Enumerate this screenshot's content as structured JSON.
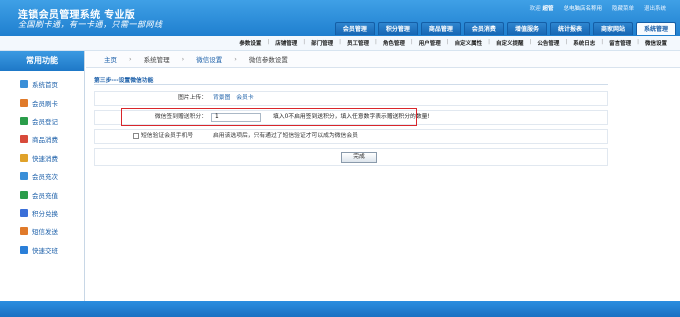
{
  "app": {
    "title": "连锁会员管理系统 专业版",
    "slogan": "全国刷卡通，有一卡通，只需一部网线"
  },
  "userbar": {
    "welcome": "欢迎",
    "username": "超管",
    "shop": "总电脑店名称用",
    "switch_label": "隐藏菜单",
    "logout_label": "退出系统"
  },
  "main_tabs": [
    "会员管理",
    "积分管理",
    "商品管理",
    "会员消费",
    "增值服务",
    "统计报表",
    "商家网站",
    "系统管理"
  ],
  "main_tab_active": "系统管理",
  "subnav": [
    "参数设置",
    "店铺管理",
    "部门管理",
    "员工管理",
    "角色管理",
    "用户管理",
    "自定义属性",
    "自定义提醒",
    "公告管理",
    "系统日志",
    "留言管理",
    "微信设置"
  ],
  "sidebar": {
    "title": "常用功能",
    "items": [
      {
        "label": "系统首页",
        "icon": "home-icon",
        "color": "#3a8fd8"
      },
      {
        "label": "会员刷卡",
        "icon": "user-card-icon",
        "color": "#e07a2a"
      },
      {
        "label": "会员登记",
        "icon": "user-add-icon",
        "color": "#2a9d4a"
      },
      {
        "label": "商品消费",
        "icon": "shopping-icon",
        "color": "#d84a3a"
      },
      {
        "label": "快速消费",
        "icon": "fast-pay-icon",
        "color": "#e0a22a"
      },
      {
        "label": "会员充次",
        "icon": "recharge-times-icon",
        "color": "#3a8fd8"
      },
      {
        "label": "会员充值",
        "icon": "recharge-money-icon",
        "color": "#2a9d4a"
      },
      {
        "label": "积分兑换",
        "icon": "points-icon",
        "color": "#3a6fd8"
      },
      {
        "label": "短信发送",
        "icon": "sms-icon",
        "color": "#e07a2a"
      },
      {
        "label": "快速交班",
        "icon": "shift-icon",
        "color": "#2a7fd8"
      }
    ]
  },
  "breadcrumb": [
    "主页",
    "系统管理",
    "微信设置",
    "微信参数设置"
  ],
  "step_title": "第三步---设置微信功能",
  "form": {
    "image_label": "图片上传：",
    "image_links": [
      "背景图",
      "会员卡"
    ],
    "points_label": "微信签到赠送积分：",
    "points_value": "1",
    "points_hint": "填入0不启用签到送积分，填入任意数字表示赠送积分的数量!",
    "sms_label": "短信验证会员手机号",
    "sms_hint": "启用该选项后，只有通过了短信验证才可以成为微信会员",
    "submit_label": "完成"
  },
  "colors": {
    "header_blue": "#1f7fcf",
    "highlight_red": "#d9262b",
    "link_blue": "#1a5ea8"
  }
}
